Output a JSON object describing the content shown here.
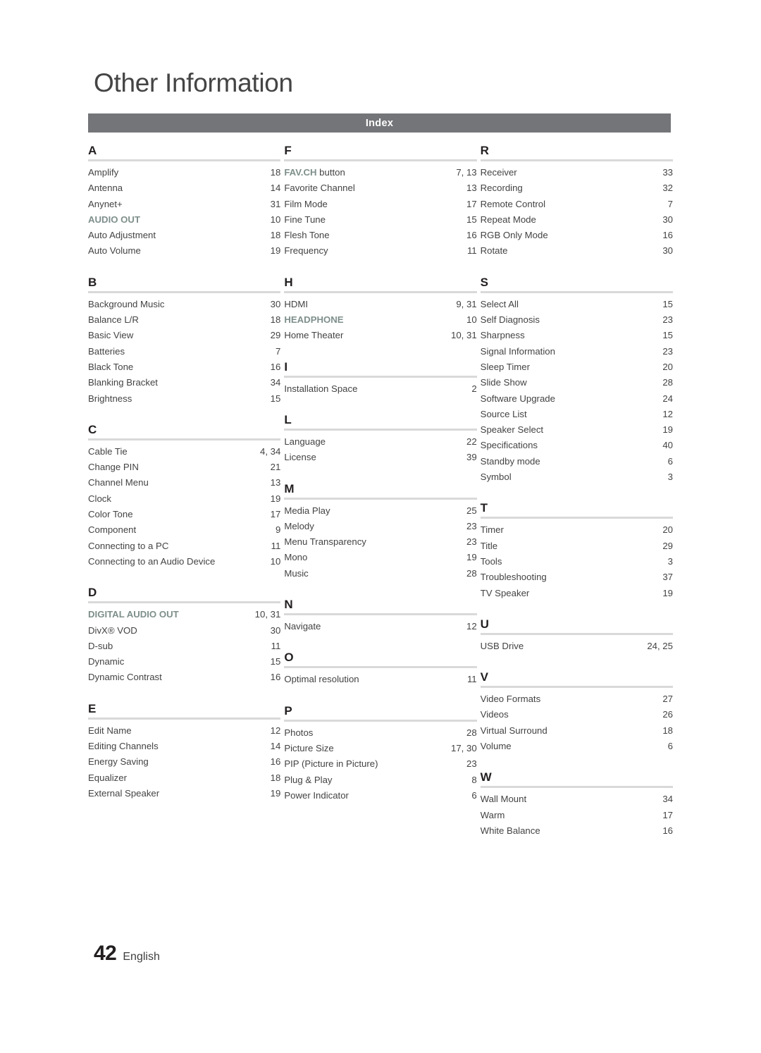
{
  "header": {
    "chapter_title": "Other Information",
    "index_bar_label": "Index",
    "index_bar_color": "#747578"
  },
  "accent_color": "#7e8f8b",
  "footer": {
    "page_number": "42",
    "language": "English"
  },
  "columns": [
    {
      "groups": [
        {
          "letter": "A",
          "entries": [
            {
              "label": "Amplify",
              "page": "18"
            },
            {
              "label": "Antenna",
              "page": "14"
            },
            {
              "label": "Anynet+",
              "page": "31"
            },
            {
              "label": "AUDIO OUT",
              "page": "10",
              "accent": true
            },
            {
              "label": "Auto Adjustment",
              "page": "18"
            },
            {
              "label": "Auto Volume",
              "page": "19"
            }
          ]
        },
        {
          "letter": "B",
          "entries": [
            {
              "label": "Background Music",
              "page": "30"
            },
            {
              "label": "Balance  L/R",
              "page": "18"
            },
            {
              "label": "Basic View",
              "page": "29"
            },
            {
              "label": "Batteries",
              "page": "7"
            },
            {
              "label": "Black Tone",
              "page": "16"
            },
            {
              "label": "Blanking Bracket",
              "page": "34"
            },
            {
              "label": "Brightness",
              "page": "15"
            }
          ]
        },
        {
          "letter": "C",
          "entries": [
            {
              "label": "Cable Tie",
              "page": "4, 34"
            },
            {
              "label": "Change PIN",
              "page": "21"
            },
            {
              "label": "Channel Menu",
              "page": "13"
            },
            {
              "label": "Clock",
              "page": "19"
            },
            {
              "label": "Color Tone",
              "page": "17"
            },
            {
              "label": "Component",
              "page": "9"
            },
            {
              "label": "Connecting to a PC",
              "page": "11"
            },
            {
              "label": "Connecting to an Audio Device",
              "page": "10"
            }
          ]
        },
        {
          "letter": "D",
          "entries": [
            {
              "label": "DIGITAL AUDIO OUT",
              "page": "10, 31",
              "accent": true
            },
            {
              "label": "DivX® VOD",
              "page": "30"
            },
            {
              "label": "D-sub",
              "page": "11"
            },
            {
              "label": "Dynamic",
              "page": "15"
            },
            {
              "label": "Dynamic Contrast",
              "page": "16"
            }
          ]
        },
        {
          "letter": "E",
          "entries": [
            {
              "label": "Edit Name",
              "page": "12"
            },
            {
              "label": "Editing Channels",
              "page": "14"
            },
            {
              "label": "Energy Saving",
              "page": "16"
            },
            {
              "label": "Equalizer",
              "page": "18"
            },
            {
              "label": "External Speaker",
              "page": "19"
            }
          ]
        }
      ]
    },
    {
      "groups": [
        {
          "letter": "F",
          "entries": [
            {
              "label": "FAV.CH",
              "suffix": " button",
              "page": "7, 13",
              "accent": true
            },
            {
              "label": "Favorite Channel",
              "page": "13"
            },
            {
              "label": "Film Mode",
              "page": "17"
            },
            {
              "label": "Fine Tune",
              "page": "15"
            },
            {
              "label": "Flesh Tone",
              "page": "16"
            },
            {
              "label": "Frequency",
              "page": "11"
            }
          ]
        },
        {
          "letter": "H",
          "entries": [
            {
              "label": "HDMI",
              "page": "9, 31"
            },
            {
              "label": "HEADPHONE",
              "page": "10",
              "accent": true
            },
            {
              "label": "Home Theater",
              "page": "10, 31"
            }
          ]
        },
        {
          "letter": "I",
          "entries": [
            {
              "label": "Installation Space",
              "page": "2"
            }
          ]
        },
        {
          "letter": "L",
          "entries": [
            {
              "label": "Language",
              "page": "22"
            },
            {
              "label": "License",
              "page": "39"
            }
          ]
        },
        {
          "letter": "M",
          "entries": [
            {
              "label": "Media Play",
              "page": "25"
            },
            {
              "label": "Melody",
              "page": "23"
            },
            {
              "label": "Menu Transparency",
              "page": "23"
            },
            {
              "label": "Mono",
              "page": "19"
            },
            {
              "label": "Music",
              "page": "28"
            }
          ]
        },
        {
          "letter": "N",
          "entries": [
            {
              "label": "Navigate",
              "page": "12"
            }
          ]
        },
        {
          "letter": "O",
          "entries": [
            {
              "label": "Optimal resolution",
              "page": "11"
            }
          ]
        },
        {
          "letter": "P",
          "entries": [
            {
              "label": "Photos",
              "page": "28"
            },
            {
              "label": "Picture Size",
              "page": "17, 30"
            },
            {
              "label": "PIP (Picture in Picture)",
              "page": "23"
            },
            {
              "label": "Plug & Play",
              "page": "8"
            },
            {
              "label": "Power Indicator",
              "page": "6"
            }
          ]
        }
      ]
    },
    {
      "groups": [
        {
          "letter": "R",
          "entries": [
            {
              "label": "Receiver",
              "page": "33"
            },
            {
              "label": "Recording",
              "page": "32"
            },
            {
              "label": "Remote Control",
              "page": "7"
            },
            {
              "label": "Repeat Mode",
              "page": "30"
            },
            {
              "label": "RGB Only Mode",
              "page": "16"
            },
            {
              "label": "Rotate",
              "page": "30"
            }
          ]
        },
        {
          "letter": "S",
          "entries": [
            {
              "label": "Select All",
              "page": "15"
            },
            {
              "label": "Self Diagnosis",
              "page": "23"
            },
            {
              "label": "Sharpness",
              "page": "15"
            },
            {
              "label": "Signal Information",
              "page": "23"
            },
            {
              "label": "Sleep Timer",
              "page": "20"
            },
            {
              "label": "Slide Show",
              "page": "28"
            },
            {
              "label": "Software Upgrade",
              "page": "24"
            },
            {
              "label": "Source List",
              "page": "12"
            },
            {
              "label": "Speaker Select",
              "page": "19"
            },
            {
              "label": "Specifications",
              "page": "40"
            },
            {
              "label": "Standby mode",
              "page": "6"
            },
            {
              "label": "Symbol",
              "page": "3"
            }
          ]
        },
        {
          "letter": "T",
          "entries": [
            {
              "label": "Timer",
              "page": "20"
            },
            {
              "label": "Title",
              "page": "29"
            },
            {
              "label": "Tools",
              "page": "3"
            },
            {
              "label": "Troubleshooting",
              "page": "37"
            },
            {
              "label": "TV Speaker",
              "page": "19"
            }
          ]
        },
        {
          "letter": "U",
          "entries": [
            {
              "label": "USB Drive",
              "page": "24, 25"
            }
          ]
        },
        {
          "letter": "V",
          "entries": [
            {
              "label": "Video Formats",
              "page": "27"
            },
            {
              "label": "Videos",
              "page": "26"
            },
            {
              "label": "Virtual Surround",
              "page": "18"
            },
            {
              "label": "Volume",
              "page": "6"
            }
          ]
        },
        {
          "letter": "W",
          "entries": [
            {
              "label": "Wall Mount",
              "page": "34"
            },
            {
              "label": "Warm",
              "page": "17"
            },
            {
              "label": "White Balance",
              "page": "16"
            }
          ]
        }
      ]
    }
  ]
}
